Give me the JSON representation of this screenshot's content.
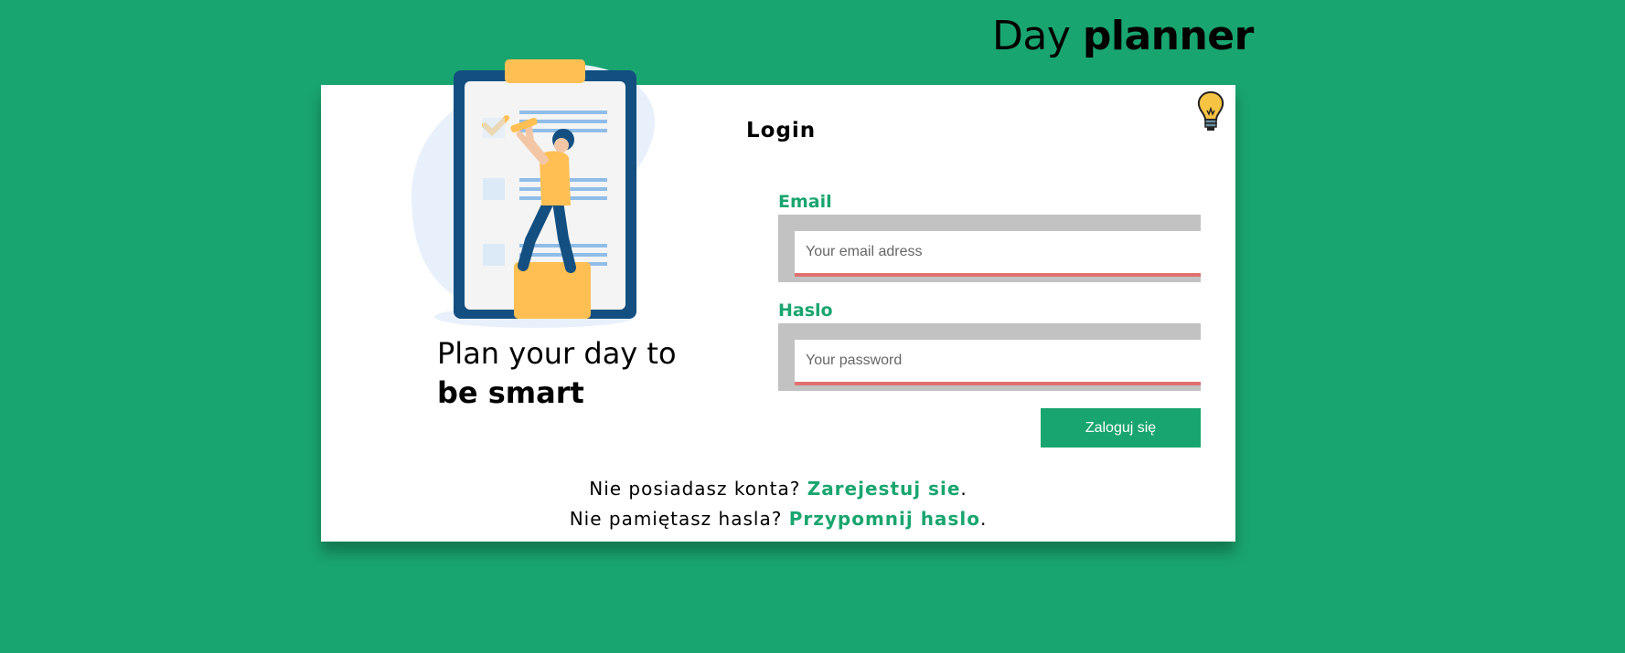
{
  "header": {
    "title_regular": "Day",
    "title_bold": "planner"
  },
  "hero": {
    "tagline_line1": "Plan your day to",
    "tagline_line2": "be smart"
  },
  "login": {
    "title": "Login",
    "email_label": "Email",
    "email_placeholder": "Your email adress",
    "password_label": "Haslo",
    "password_placeholder": "Your password",
    "submit_label": "Zaloguj się"
  },
  "footer": {
    "register_prompt": "Nie posiadasz konta?",
    "register_link": "Zarejestuj sie",
    "forgot_prompt": "Nie pamiętasz hasla?",
    "forgot_link": "Przypomnij haslo",
    "period": "."
  },
  "icons": {
    "theme_toggle": "lightbulb-icon",
    "illustration": "clipboard-checklist-illustration"
  },
  "colors": {
    "background": "#19a56f",
    "accent": "#19a56f",
    "input_underline": "#e07070",
    "input_frame": "#c2c2c2",
    "bulb": "#f6c343"
  }
}
